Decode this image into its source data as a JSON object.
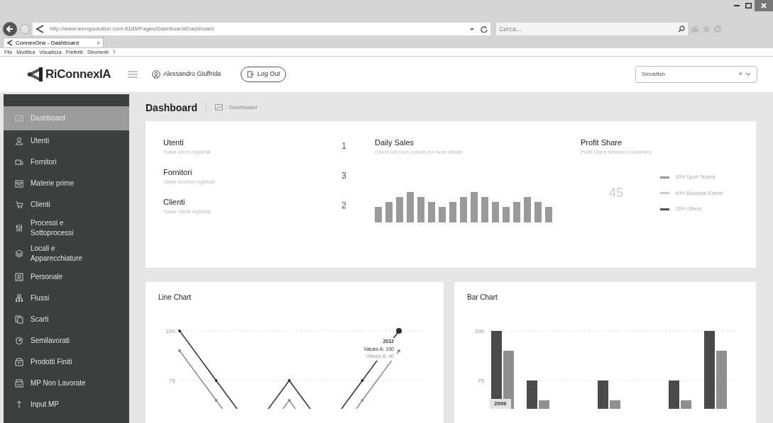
{
  "browser": {
    "url": "http://www.ieengsolution.com:8185/Pages/Dashboard/Dashboard",
    "search_placeholder": "Cerca...",
    "tab": {
      "title": "ConnexOne - Dashboard",
      "close": "×"
    },
    "menu": [
      "File",
      "Modifica",
      "Visualizza",
      "Preferiti",
      "Strumenti",
      "?"
    ]
  },
  "header": {
    "logo": "RiConnexIA",
    "user": "Alessandro Giuffrida",
    "logout": "Log Out",
    "select": {
      "value": "Smokfish",
      "clear": "×"
    }
  },
  "sidebar": {
    "items": [
      {
        "label": "Dashboard",
        "selected": true
      },
      {
        "label": "Utenti",
        "selected": false
      },
      {
        "label": "Fornitori",
        "selected": false
      },
      {
        "label": "Materie prime",
        "selected": false
      },
      {
        "label": "Clienti",
        "selected": false
      },
      {
        "label": "Processi e Sottoprocessi",
        "selected": false
      },
      {
        "label": "Locali e Apparecchiature",
        "selected": false
      },
      {
        "label": "Personale",
        "selected": false
      },
      {
        "label": "Flussi",
        "selected": false
      },
      {
        "label": "Scarti",
        "selected": false
      },
      {
        "label": "Semilavorati",
        "selected": false
      },
      {
        "label": "Prodotti Finiti",
        "selected": false
      },
      {
        "label": "MP Non Lavorate",
        "selected": false
      },
      {
        "label": "Input MP",
        "selected": false
      }
    ]
  },
  "page": {
    "title": "Dashboard",
    "breadcrumb": "- Dashboard"
  },
  "stats": [
    {
      "title": "Utenti",
      "subtitle": "Totale utenti registrati",
      "value": "1"
    },
    {
      "title": "Fornitori",
      "subtitle": "Totale fornitori registrati",
      "value": "3"
    },
    {
      "title": "Clienti",
      "subtitle": "Totale clienti registrati",
      "value": "2"
    }
  ],
  "daily_sales": {
    "title": "Daily Sales",
    "subtitle": "Check out each column for more details"
  },
  "profit_share": {
    "title": "Profit Share",
    "subtitle": "Profit Share between customers",
    "center": "45",
    "legend": [
      {
        "label": "30% Sport Tickets",
        "color": "#9a9a9a"
      },
      {
        "label": "40% Business Events",
        "color": "#c8c8c8"
      },
      {
        "label": "15% Others",
        "color": "#555555"
      }
    ]
  },
  "line_chart": {
    "title": "Line Chart",
    "kind": "line",
    "y_labels": [
      "100",
      "75"
    ],
    "tooltip": {
      "title": "2012",
      "lines": [
        "Values A: 100",
        "Values B: 90"
      ]
    }
  },
  "bar_chart": {
    "title": "Bar Chart",
    "kind": "bar",
    "y_labels": [
      "100",
      "75"
    ],
    "category_label": "2006"
  }
}
